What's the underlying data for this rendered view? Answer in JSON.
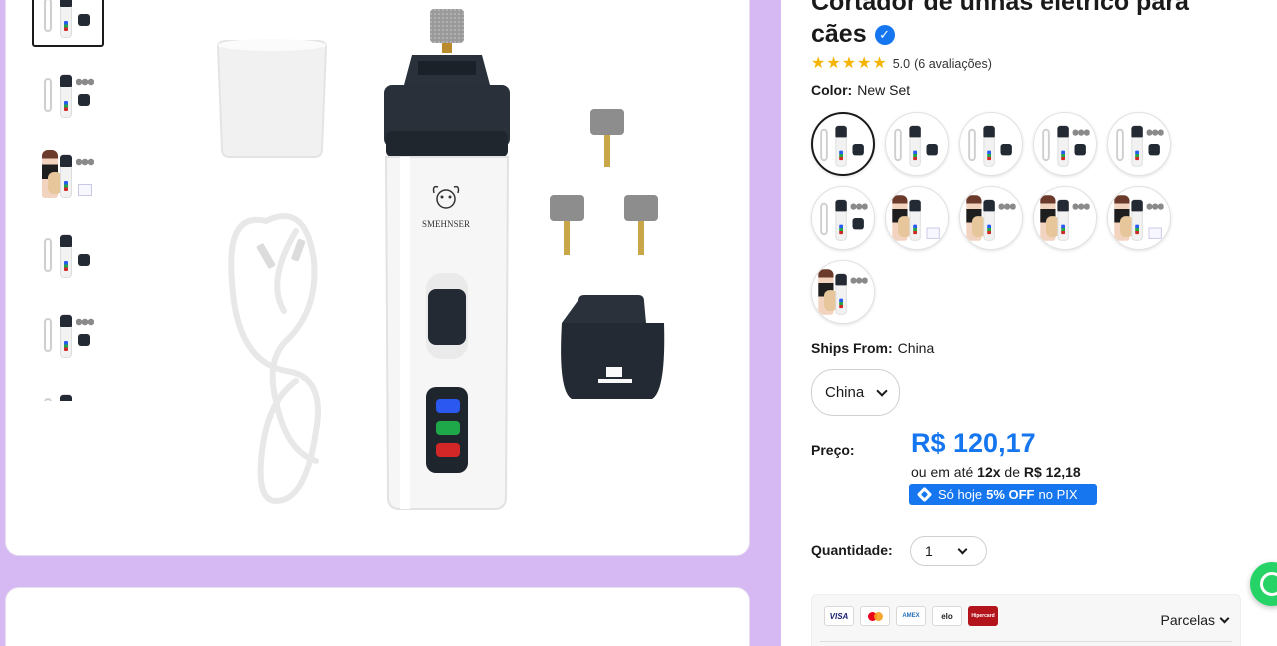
{
  "product": {
    "title_line1": "Cortador de unhas elétrico para",
    "title_line2": "cães",
    "rating_value": "5.0",
    "rating_count": "(6 avaliações)",
    "stars": 5
  },
  "color": {
    "label": "Color:",
    "value": "New Set",
    "swatch_count": 11,
    "selected_index": 0
  },
  "ships_from": {
    "label": "Ships From:",
    "value": "China",
    "select_value": "China"
  },
  "price": {
    "label": "Preço:",
    "value": "R$ 120,17",
    "installment_prefix": "ou em até",
    "installment_count": "12x",
    "installment_mid": "de",
    "installment_value": "R$ 12,18",
    "pix_prefix": "Só hoje",
    "pix_discount": "5% OFF",
    "pix_suffix": "no PIX"
  },
  "quantity": {
    "label": "Quantidade:",
    "value": "1"
  },
  "payment": {
    "icons": [
      "VISA",
      "",
      "AMEX",
      "elo",
      "Hipercard"
    ],
    "parcelas_label": "Parcelas"
  },
  "gallery": {
    "brand_text": "SMEHNSER",
    "thumb_count": 6,
    "active_thumb": 0
  },
  "colors": {
    "accent": "#1576f0",
    "background": "#d6b8f3",
    "whatsapp": "#25d366"
  }
}
